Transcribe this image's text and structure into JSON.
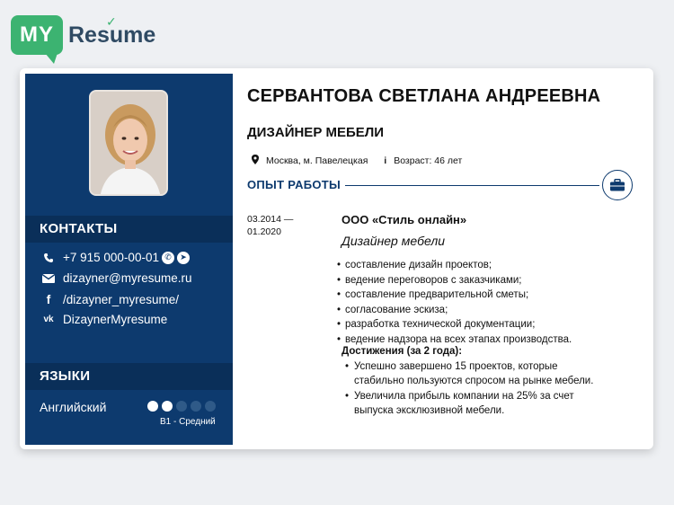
{
  "logo": {
    "badge": "MY",
    "word": "Resume"
  },
  "sidebar": {
    "contacts_title": "КОНТАКТЫ",
    "phone": "+7 915 000-00-01",
    "email": "dizayner@myresume.ru",
    "facebook": "/dizayner_myresume/",
    "vk": "DizaynerMyresume",
    "languages_title": "ЯЗЫКИ",
    "language": {
      "name": "Английский",
      "level": "B1 - Средний",
      "dots_filled": 2,
      "dots_total": 5
    }
  },
  "header": {
    "name": "СЕРВАНТОВА СВЕТЛАНА АНДРЕЕВНА",
    "job_title": "ДИЗАЙНЕР МЕБЕЛИ",
    "location": "Москва, м. Павелецкая",
    "age": "Возраст: 46 лет"
  },
  "experience": {
    "title": "ОПЫТ РАБОТЫ",
    "dates_start": "03.2014 —",
    "dates_end": "01.2020",
    "company": "ООО «Стиль онлайн»",
    "position": "Дизайнер мебели",
    "duties": [
      "составление дизайн проектов;",
      "ведение переговоров с заказчиками;",
      "составление предварительной сметы;",
      "согласование эскиза;",
      "разработка технической документации;",
      "ведение надзора на всех этапах производства."
    ],
    "achievements_title": "Достижения (за 2 года):",
    "achievements": [
      "Успешно завершено 15 проектов, которые стабильно пользуются спросом на рынке мебели.",
      "Увеличила прибыль компании на 25% за счет выпуска эксклюзивной мебели."
    ]
  },
  "colors": {
    "sidebar": "#0d3a6e",
    "accent_green": "#3cb371"
  },
  "icons": {
    "phone": "phone-icon",
    "whatsapp": "whatsapp-icon",
    "telegram": "telegram-icon",
    "email": "envelope-icon",
    "facebook": "facebook-icon",
    "vk": "vk-icon",
    "location": "location-pin-icon",
    "info": "info-icon",
    "experience": "briefcase-icon"
  }
}
